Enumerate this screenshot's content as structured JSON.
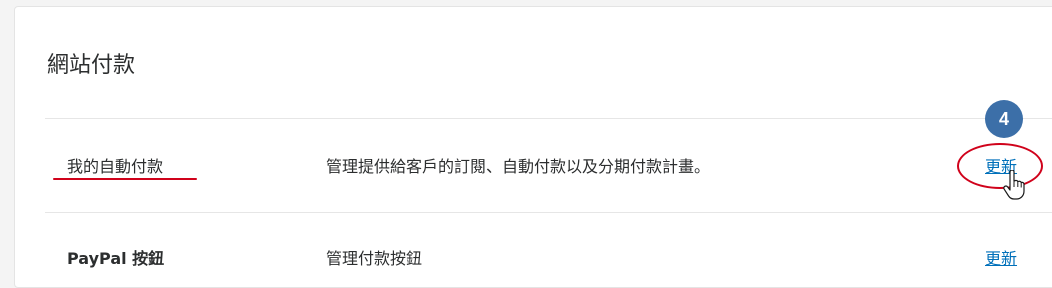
{
  "section": {
    "title": "網站付款"
  },
  "rows": [
    {
      "title": "我的自動付款",
      "description": "管理提供給客戶的訂閱、自動付款以及分期付款計畫。",
      "action": "更新"
    },
    {
      "title": "PayPal 按鈕",
      "description": "管理付款按鈕",
      "action": "更新"
    }
  ],
  "annotation": {
    "step_number": "4",
    "highlight_color": "#d0021b",
    "badge_color": "#3c6fa8"
  },
  "colors": {
    "link": "#0070ba",
    "text": "#2c2e2f"
  },
  "icons": {
    "cursor": "hand-pointer-icon"
  }
}
